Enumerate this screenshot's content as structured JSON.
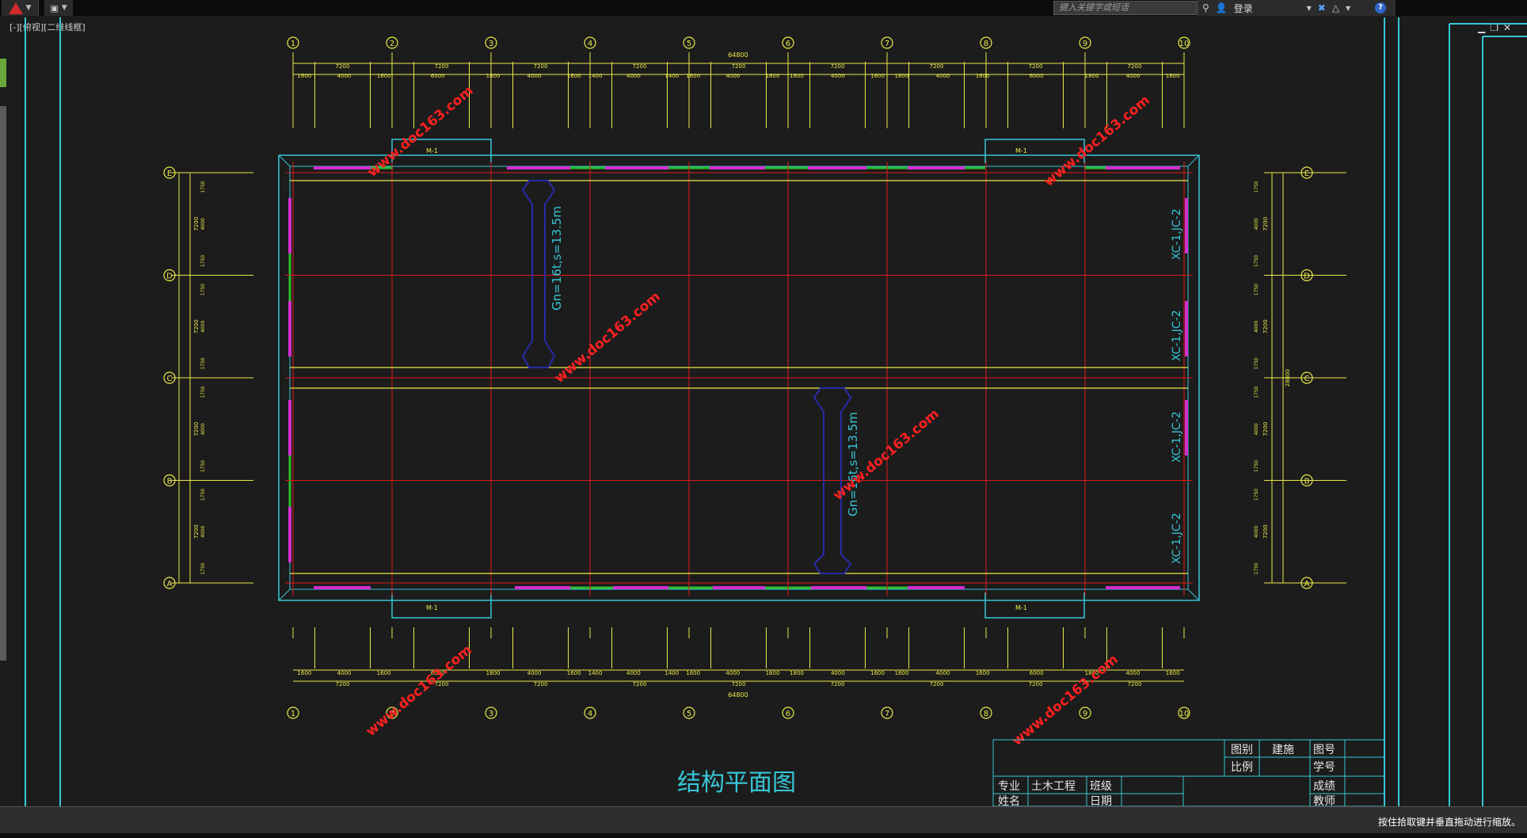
{
  "app": {
    "search_placeholder": "键入关键字或短语",
    "login_label": "登录",
    "viewport_label": "[-][俯视][二维线框]",
    "status_hint": "按住拾取键并垂直拖动进行缩放。"
  },
  "drawing": {
    "title": "结构平面图",
    "column_axes": [
      "1",
      "2",
      "3",
      "4",
      "5",
      "6",
      "7",
      "8",
      "9",
      "10"
    ],
    "row_axes": [
      "E",
      "D",
      "C",
      "B",
      "A"
    ],
    "overall_length": "64800",
    "bay_spacing": [
      "7200",
      "7200",
      "7200",
      "7200",
      "7200",
      "7200",
      "7200",
      "7200",
      "7200"
    ],
    "top_segments": [
      "1600",
      "4000",
      "1600",
      "6000",
      "1800",
      "4000",
      "1600",
      "1400",
      "4000",
      "1400",
      "1600",
      "4000",
      "1600",
      "1800",
      "4000",
      "1600",
      "1800",
      "4000",
      "1600",
      "6000",
      "1800",
      "4000",
      "1600"
    ],
    "crane_label_1": "Gn=16t,s=13.5m",
    "crane_label_2": "Gn=16t,s=13.5m",
    "side_labels": [
      "XC-1,JC-2",
      "XC-1,JC-2",
      "XC-1,JC-2",
      "XC-1,JC-2"
    ],
    "door_label": "M-1",
    "watermark": "www.doc163.com",
    "left_dims": [
      "1750",
      "4000",
      "1750",
      "7200"
    ],
    "total_width": "28800"
  },
  "titleblock": {
    "drawing_type_label": "图别",
    "drawing_type_value": "建施",
    "drawing_no_label": "图号",
    "scale_label": "比例",
    "student_no_label": "学号",
    "major_label": "专业",
    "major_value": "土木工程",
    "class_label": "班级",
    "grade_label": "成绩",
    "name_label": "姓名",
    "date_label": "日期",
    "teacher_label": "教师"
  },
  "colors": {
    "background": "#1c1c1c",
    "axis_yellow": "#e8e84a",
    "grid_red": "#e01a1a",
    "wall_cyan": "#36c6d6",
    "crane_blue": "#2a2aaa",
    "window_magenta": "#d22fd2",
    "watermark_red": "#ff2020"
  }
}
